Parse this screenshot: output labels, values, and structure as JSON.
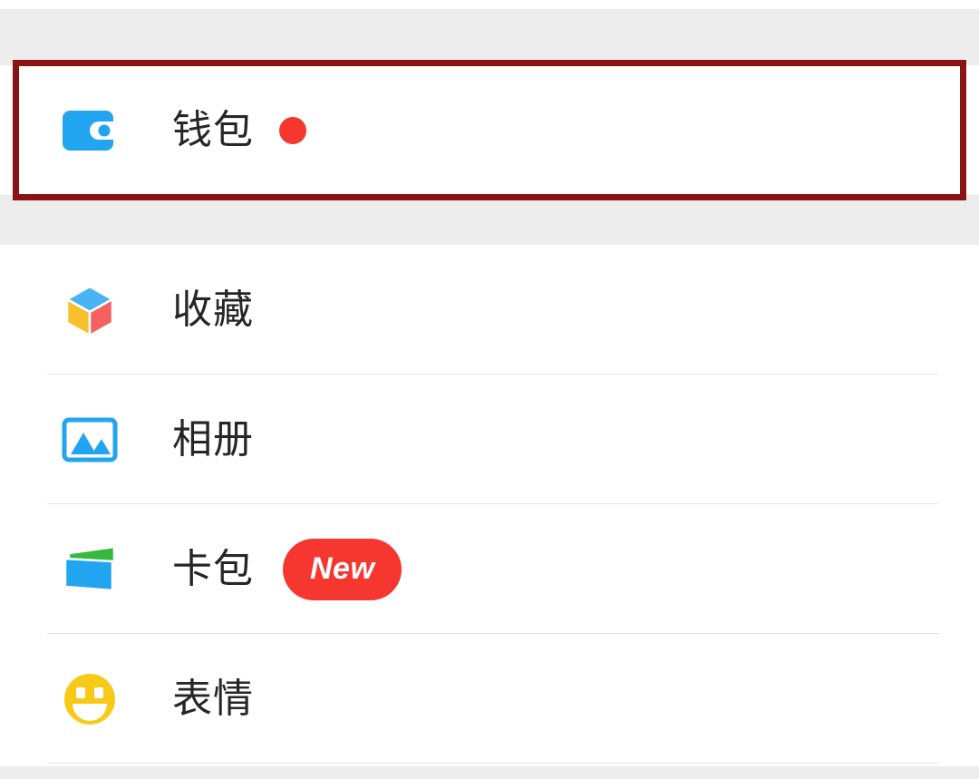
{
  "screen": {
    "background_color": "#ededed",
    "card_background_color": "#ffffff",
    "separator_color": "#e3e3e3",
    "label_color": "#262626",
    "accent_red": "#f5372f",
    "annotation_color": "#8c1313"
  },
  "annotation": {
    "target": "wallet-row",
    "label": "highlight-box"
  },
  "wallet_group": {
    "items": [
      {
        "id": "wallet",
        "label": "钱包",
        "icon": "wallet-icon",
        "icon_color": "#22a5f1",
        "badge_type": "dot",
        "badge_color": "#f5372f",
        "badge_text": ""
      }
    ]
  },
  "list_group": {
    "items": [
      {
        "id": "favorites",
        "label": "收藏",
        "icon": "cube-icon",
        "icon_colors": [
          "#4ab3f4",
          "#f7c12c",
          "#f4615f"
        ],
        "badge_type": "none",
        "badge_text": ""
      },
      {
        "id": "album",
        "label": "相册",
        "icon": "photo-icon",
        "icon_color": "#22a5f1",
        "badge_type": "none",
        "badge_text": ""
      },
      {
        "id": "cards",
        "label": "卡包",
        "icon": "cards-icon",
        "icon_colors": [
          "#35b93c",
          "#22a5f1"
        ],
        "badge_type": "pill",
        "badge_color": "#f5372f",
        "badge_text": "New"
      },
      {
        "id": "stickers",
        "label": "表情",
        "icon": "smiley-icon",
        "icon_color": "#f7ca18",
        "badge_type": "none",
        "badge_text": ""
      }
    ]
  }
}
